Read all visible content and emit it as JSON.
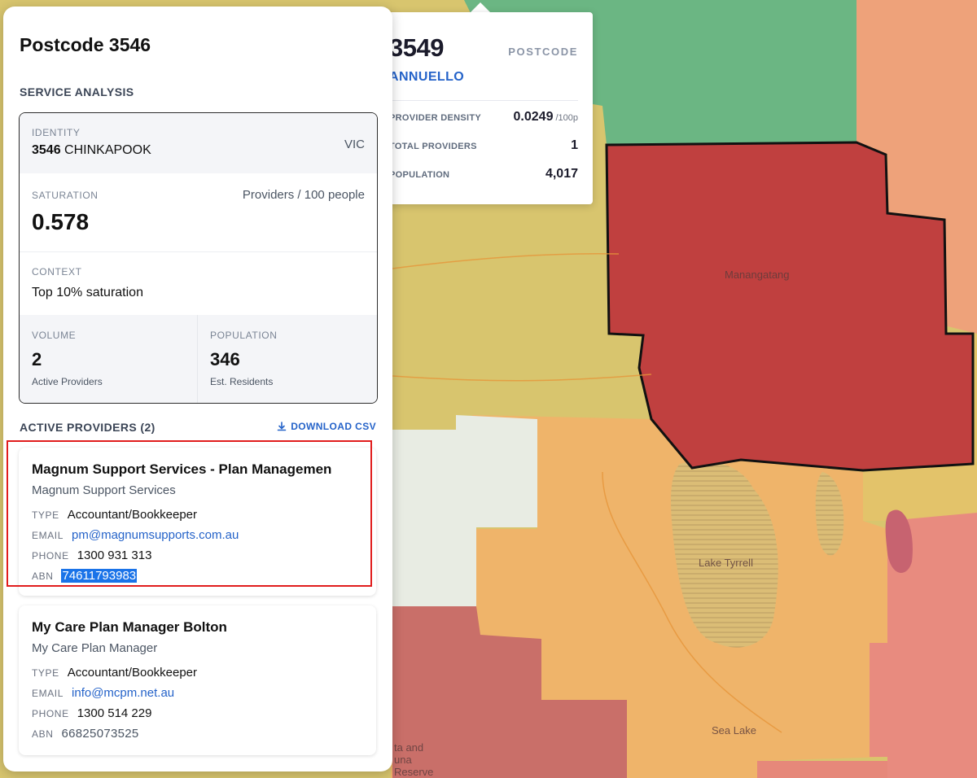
{
  "panel": {
    "title": "Postcode 3546",
    "service_analysis_label": "SERVICE ANALYSIS",
    "identity": {
      "label": "IDENTITY",
      "postcode": "3546",
      "locality": "CHINKAPOOK",
      "state": "VIC"
    },
    "saturation": {
      "label": "SATURATION",
      "value": "0.578",
      "unit": "Providers / 100 people"
    },
    "context": {
      "label": "CONTEXT",
      "value": "Top 10% saturation"
    },
    "volume": {
      "label": "VOLUME",
      "value": "2",
      "sub": "Active Providers"
    },
    "population": {
      "label": "POPULATION",
      "value": "346",
      "sub": "Est. Residents"
    },
    "providers_label": "ACTIVE PROVIDERS (2)",
    "download_label": "DOWNLOAD CSV",
    "providers": [
      {
        "name": "Magnum Support Services - Plan Managemen",
        "org": "Magnum Support Services",
        "type_label": "TYPE",
        "type": "Accountant/Bookkeeper",
        "email_label": "EMAIL",
        "email": "pm@magnumsupports.com.au",
        "phone_label": "PHONE",
        "phone": "1300 931 313",
        "abn_label": "ABN",
        "abn": "74611793983"
      },
      {
        "name": "My Care Plan Manager Bolton",
        "org": "My Care Plan Manager",
        "type_label": "TYPE",
        "type": "Accountant/Bookkeeper",
        "email_label": "EMAIL",
        "email": "info@mcpm.net.au",
        "phone_label": "PHONE",
        "phone": "1300 514 229",
        "abn_label": "ABN",
        "abn": "66825073525"
      }
    ]
  },
  "tooltip": {
    "postcode": "3549",
    "kind_label": "POSTCODE",
    "locality": "ANNUELLO",
    "rows": [
      {
        "label": "PROVIDER DENSITY",
        "value": "0.0249",
        "unit": "/100p"
      },
      {
        "label": "TOTAL PROVIDERS",
        "value": "1",
        "unit": ""
      },
      {
        "label": "POPULATION",
        "value": "4,017",
        "unit": ""
      }
    ]
  },
  "map": {
    "labels": [
      "Manangatang",
      "Lake Tyrrell",
      "Sea Lake",
      "ta and",
      "una",
      "Reserve"
    ]
  },
  "colors": {
    "accent": "#2563c9",
    "highlight": "#e11d1d",
    "selection": "#1a73e8"
  }
}
